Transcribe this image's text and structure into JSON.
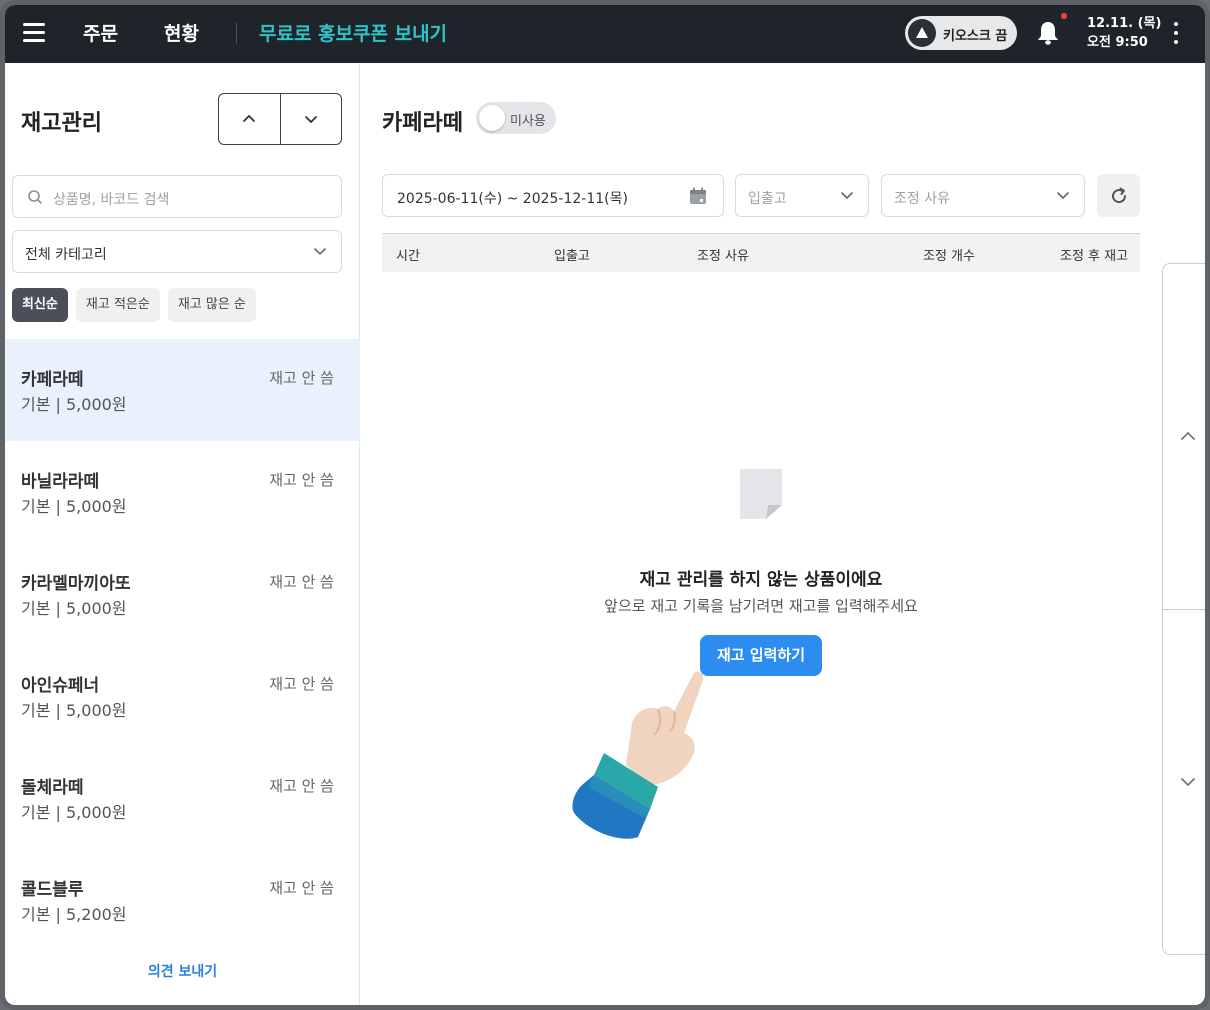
{
  "topbar": {
    "nav": [
      "주문",
      "현황"
    ],
    "promo": "무료로 홍보쿠폰 보내기",
    "kiosk_label": "키오스크 끔",
    "date": "12.11. (목)",
    "time": "오전 9:50",
    "accent_color": "#2ec4c8",
    "notification_dot_color": "#f0443c"
  },
  "left": {
    "title": "재고관리",
    "search_placeholder": "상품명, 바코드 검색",
    "category": "전체 카테고리",
    "sort_chips": [
      {
        "label": "최신순",
        "active": true
      },
      {
        "label": "재고 적은순",
        "active": false
      },
      {
        "label": "재고 많은 순",
        "active": false
      }
    ],
    "items": [
      {
        "name": "카페라떼",
        "sub": "기본 | 5,000원",
        "stock": "재고 안 씀",
        "selected": true
      },
      {
        "name": "바닐라라떼",
        "sub": "기본 | 5,000원",
        "stock": "재고 안 씀",
        "selected": false
      },
      {
        "name": "카라멜마끼아또",
        "sub": "기본 | 5,000원",
        "stock": "재고 안 씀",
        "selected": false
      },
      {
        "name": "아인슈페너",
        "sub": "기본 | 5,000원",
        "stock": "재고 안 씀",
        "selected": false
      },
      {
        "name": "돌체라떼",
        "sub": "기본 | 5,000원",
        "stock": "재고 안 씀",
        "selected": false
      },
      {
        "name": "콜드블루",
        "sub": "기본 | 5,200원",
        "stock": "재고 안 씀",
        "selected": false
      }
    ],
    "feedback": "의견 보내기"
  },
  "main": {
    "product_title": "카페라떼",
    "toggle_label": "미사용",
    "date_range": "2025-06-11(수) ~ 2025-12-11(목)",
    "inout_placeholder": "입출고",
    "reason_placeholder": "조정 사유",
    "columns": [
      "시간",
      "입출고",
      "조정 사유",
      "조정 개수",
      "조정 후 재고"
    ],
    "empty_title": "재고 관리를 하지 않는 상품이에요",
    "empty_sub": "앞으로 재고 기록을 남기려면 재고를 입력해주세요",
    "cta": "재고 입력하기",
    "cta_color": "#2d8cf0"
  },
  "icons": [
    "menu-icon",
    "bell-icon",
    "more-icon",
    "search-icon",
    "chevron-down-icon",
    "chevron-up-icon",
    "calendar-icon",
    "refresh-icon",
    "document-icon",
    "pointing-hand-icon"
  ]
}
